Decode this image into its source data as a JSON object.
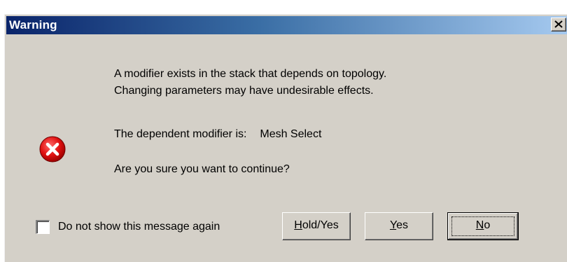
{
  "window": {
    "title": "Warning",
    "close_glyph": "✕"
  },
  "message": {
    "line1": "A modifier exists in the stack that depends on topology.",
    "line2": "Changing parameters may have undesirable effects.",
    "dependent_label": "The dependent modifier is:",
    "dependent_value": "Mesh Select",
    "question": "Are you sure you want to continue?"
  },
  "icon": {
    "name": "error-icon",
    "color": "#e01010"
  },
  "checkbox": {
    "label": "Do not show this message again",
    "checked": false
  },
  "buttons": {
    "hold_yes": {
      "mnemonic": "H",
      "rest": "old/Yes"
    },
    "yes": {
      "mnemonic": "Y",
      "rest": "es"
    },
    "no": {
      "mnemonic": "N",
      "rest": "o"
    }
  },
  "colors": {
    "title_start": "#0a246a",
    "title_end": "#a6caf0",
    "face": "#d4d0c8"
  }
}
